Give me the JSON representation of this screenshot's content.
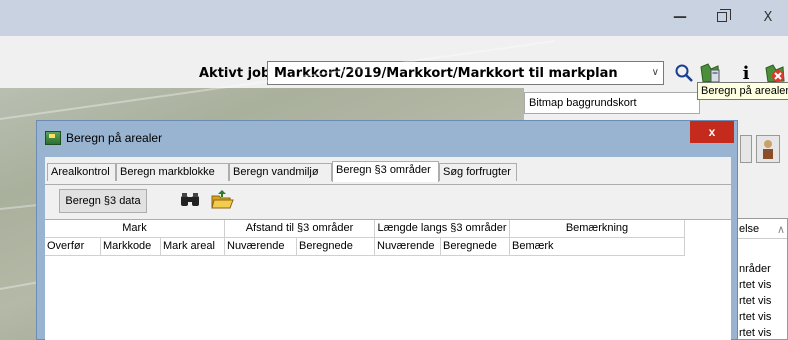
{
  "window": {
    "minimize_glyph": "—",
    "close_glyph": "X"
  },
  "job": {
    "label": "Aktivt job",
    "selected": "Markkort/2019/Markkort/Markkort til markplan"
  },
  "toolbar": {
    "info_glyph": "i",
    "tooltip": "Beregn på arealer"
  },
  "side": {
    "bitmap_field": "Bitmap baggrundskort",
    "list_header": "else",
    "list_rows": [
      "nråder",
      "rtet vis",
      "rtet vis",
      "rtet vis",
      "rtet vis"
    ]
  },
  "dialog": {
    "title": "Beregn på arealer",
    "close_label": "x",
    "tabs": [
      {
        "label": "Arealkontrol"
      },
      {
        "label": "Beregn markblokke"
      },
      {
        "label": "Beregn vandmiljø"
      },
      {
        "label": "Beregn §3 områder"
      },
      {
        "label": "Søg forfrugter"
      }
    ],
    "action_button": "Beregn §3 data",
    "group_headers": [
      "Mark",
      "Afstand til §3 områder",
      "Længde langs §3 områder",
      "Bemærkning"
    ],
    "columns": [
      "Overfør",
      "Markkode",
      "Mark areal",
      "Nuværende",
      "Beregnede",
      "Nuværende",
      "Beregnede",
      "Bemærk"
    ]
  },
  "colors": {
    "title_bar": "#c8d2e0",
    "dialog_frame": "#99b4d1",
    "close_red": "#c42b1c"
  }
}
